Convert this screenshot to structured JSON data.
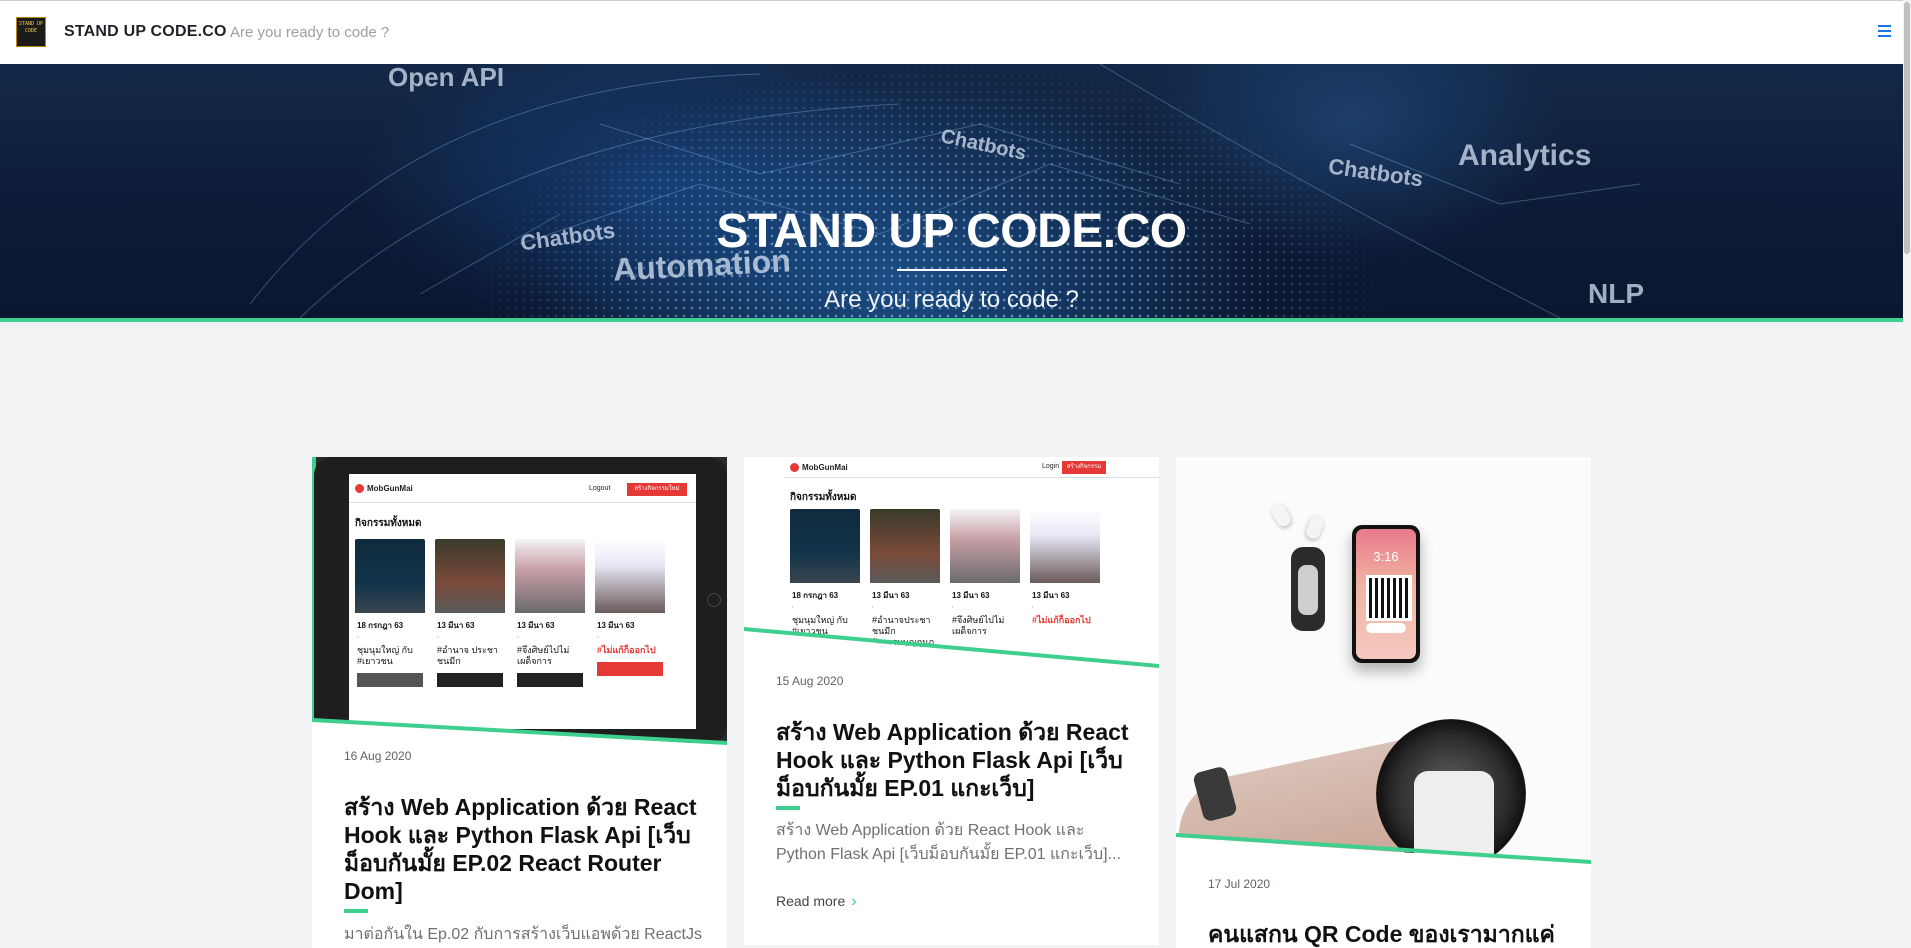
{
  "header": {
    "logo_text": "STAND UP CODE",
    "site_title": "STAND UP CODE.CO",
    "tagline": "Are you ready to code ?",
    "menu_icon": "hamburger-menu-icon"
  },
  "hero": {
    "title": "STAND UP CODE.CO",
    "subtitle": "Are you ready to code ?",
    "background_words": [
      "Open API",
      "Chatbots",
      "Analytics",
      "Chatbots",
      "Automation",
      "NLP",
      "Chatbots"
    ]
  },
  "posts": [
    {
      "date": "16 Aug 2020",
      "title": "สร้าง Web Application ด้วย React Hook และ Python Flask Api [เว็บม็อบกันมั้ย EP.02 React Router Dom]",
      "excerpt": "มาต่อกันใน Ep.02 กับการสร้างเว็บแอพด้วย ReactJs",
      "image": {
        "brand": "MobGunMai",
        "logout": "Logout",
        "create_button": "สร้างกิจกรรมใหม่",
        "section": "กิจกรรมทั้งหมด",
        "events": [
          {
            "date": "18 กรกฎา 63",
            "tag": "ชุมนุมใหญ่ กับ #เยาวชน"
          },
          {
            "date": "13 มีนา 63",
            "tag": "#อำนาจ ประชาชนมีก"
          },
          {
            "date": "13 มีนา 63",
            "tag": "#จึงศิษย์ไปไม่ เผด็จการ"
          },
          {
            "date": "13 มีนา 63",
            "tag": "#ไม่แก้ก็ออกไป"
          }
        ]
      }
    },
    {
      "date": "15 Aug 2020",
      "title": "สร้าง Web Application ด้วย React Hook และ Python Flask Api [เว็บม็อบกันมั้ย EP.01 แกะเว็บ]",
      "excerpt": "สร้าง Web Application ด้วย React Hook และ Python Flask Api [เว็บม็อบกันมั้ย EP.01 แกะเว็บ]...",
      "read_more": "Read more",
      "image": {
        "brand": "MobGunMai",
        "login": "Login",
        "create_button": "สร้างกิจกรรมใหม่",
        "section": "กิจกรรมทั้งหมด",
        "events": [
          {
            "date": "18 กรกฎา 63",
            "tag": "ชุมนุมใหญ่ กับ #เยาวชน"
          },
          {
            "date": "13 มีนา 63",
            "tag": "#อำนาจประชาชนมีก รัฐธรรมนูญกุมภ"
          },
          {
            "date": "13 มีนา 63",
            "tag": "#จึงศิษย์ไปไม่เผด็จการ"
          },
          {
            "date": "13 มีนา 63",
            "tag": "#ไม่แก้ก็ออกไป"
          }
        ]
      }
    },
    {
      "date": "17 Jul 2020",
      "title": "คนแสกน QR Code ของเรามากแค่",
      "image": {
        "phone_time": "3:16"
      }
    }
  ],
  "colors": {
    "accent": "#3ecf8e",
    "menu": "#1a73e8",
    "hero_bg": "#0c1b36",
    "page_bg": "#f1f2f4"
  }
}
